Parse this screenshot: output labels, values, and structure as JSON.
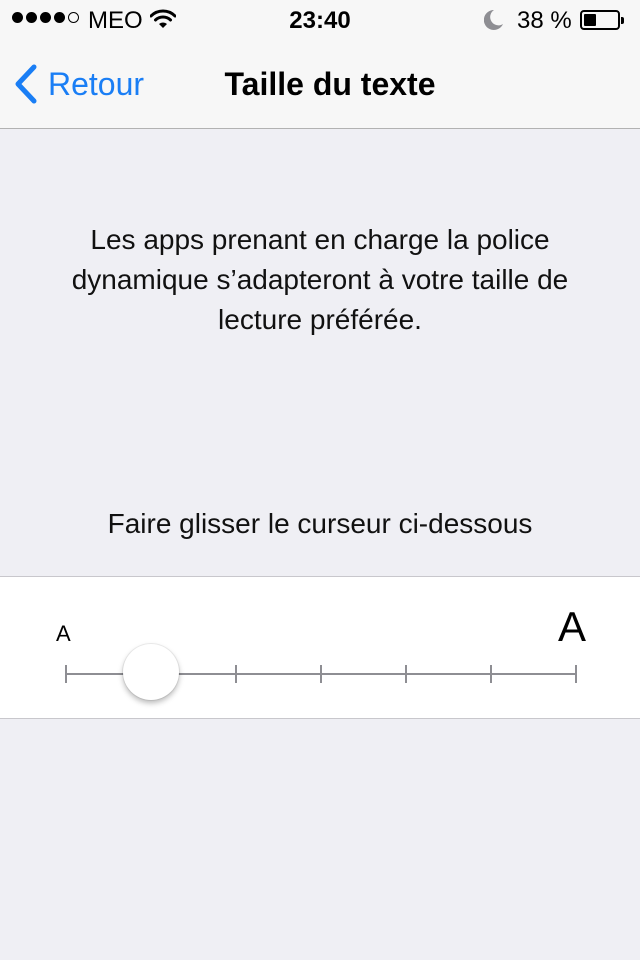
{
  "status_bar": {
    "signal_icon": "signal-dots-icon",
    "signal_bars_filled": 4,
    "signal_bars_total": 5,
    "carrier": "MEO",
    "wifi_icon": "wifi-icon",
    "time": "23:40",
    "moon_icon": "moon-icon",
    "battery_percent": "38 %",
    "battery_level": 0.38
  },
  "nav": {
    "back_icon": "chevron-left-icon",
    "back_label": "Retour",
    "title": "Taille du texte"
  },
  "main": {
    "description": "Les apps prenant en charge la police dynamique s’adapteront à votre taille de lecture préférée.",
    "hint": "Faire glisser le curseur ci-dessous"
  },
  "slider": {
    "min_label": "A",
    "max_label": "A",
    "step_count": 7,
    "selected_step": 1
  },
  "colors": {
    "accent": "#1a7ef5",
    "background": "#efeff4",
    "panel": "#ffffff"
  }
}
